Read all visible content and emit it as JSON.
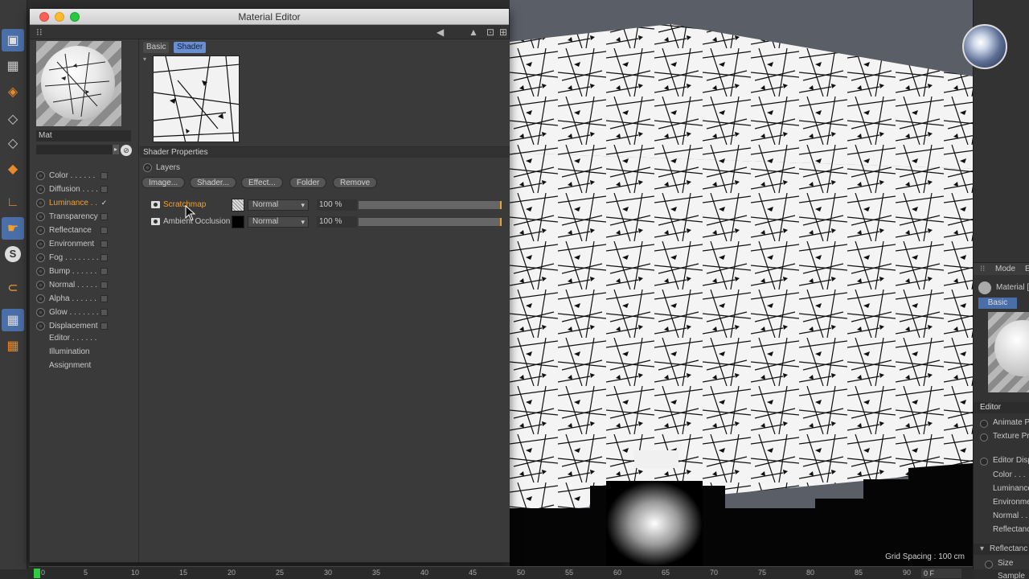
{
  "window": {
    "title": "Material Editor"
  },
  "material": {
    "name": "Mat"
  },
  "tabs": [
    {
      "label": "Basic"
    },
    {
      "label": "Shader"
    }
  ],
  "channels": [
    {
      "label": "Color . . . . . .",
      "checked": false,
      "active": false
    },
    {
      "label": "Diffusion . . . .",
      "checked": false,
      "active": false
    },
    {
      "label": "Luminance . .",
      "checked": true,
      "active": true
    },
    {
      "label": "Transparency",
      "checked": false,
      "active": false
    },
    {
      "label": "Reflectance",
      "checked": false,
      "active": false
    },
    {
      "label": "Environment",
      "checked": false,
      "active": false
    },
    {
      "label": "Fog . . . . . . . .",
      "checked": false,
      "active": false
    },
    {
      "label": "Bump . . . . . .",
      "checked": false,
      "active": false
    },
    {
      "label": "Normal . . . . .",
      "checked": false,
      "active": false
    },
    {
      "label": "Alpha . . . . . .",
      "checked": false,
      "active": false
    },
    {
      "label": "Glow . . . . . . .",
      "checked": false,
      "active": false
    },
    {
      "label": "Displacement",
      "checked": false,
      "active": false
    }
  ],
  "extra_items": [
    "Editor . . . . . .",
    "Illumination",
    "Assignment"
  ],
  "shader": {
    "properties_header": "Shader Properties",
    "layers_label": "Layers",
    "buttons": [
      "Image...",
      "Shader...",
      "Effect...",
      "Folder",
      "Remove"
    ],
    "layers": [
      {
        "name": "Scratchmap",
        "mode": "Normal",
        "opacity": "100 %",
        "opacity_value": 100,
        "selected": true
      },
      {
        "name": "Ambient Occlusion",
        "mode": "Normal",
        "opacity": "100 %",
        "opacity_value": 100,
        "selected": false
      }
    ]
  },
  "viewport": {
    "grid_label": "Grid Spacing : 100 cm"
  },
  "right_panel": {
    "mode_label": "Mode",
    "extra_label": "E",
    "material_label": "Material [",
    "basic_tab": "Basic",
    "editor_header": "Editor",
    "options": [
      "Animate Pr",
      "Texture Pr"
    ],
    "editor_display": "Editor Disp",
    "display_items": [
      "Color . . .",
      "Luminance",
      "Environme",
      "Normal . .",
      "Reflectanc"
    ],
    "reflectance_header": "Reflectanc",
    "size_label": "Size",
    "sample_label": "Sample"
  },
  "timeline": {
    "ticks": [
      "0",
      "5",
      "10",
      "15",
      "20",
      "25",
      "30",
      "35",
      "40",
      "45",
      "50",
      "55",
      "60",
      "65",
      "70",
      "75",
      "80",
      "85",
      "90"
    ],
    "frame": "0 F"
  },
  "colors": {
    "accent": "#f0a030",
    "shader_tab": "#6a8ed0"
  }
}
